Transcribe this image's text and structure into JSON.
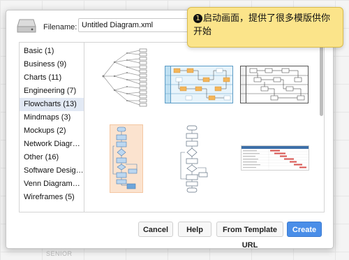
{
  "dialog": {
    "filename_label": "Filename:",
    "filename_value": "Untitled Diagram.xml"
  },
  "categories": [
    {
      "label": "Basic (1)",
      "selected": false
    },
    {
      "label": "Business (9)",
      "selected": false
    },
    {
      "label": "Charts (11)",
      "selected": false
    },
    {
      "label": "Engineering (7)",
      "selected": false
    },
    {
      "label": "Flowcharts (13)",
      "selected": true
    },
    {
      "label": "Mindmaps (3)",
      "selected": false
    },
    {
      "label": "Mockups (2)",
      "selected": false
    },
    {
      "label": "Network Diagra…",
      "selected": false
    },
    {
      "label": "Other (16)",
      "selected": false
    },
    {
      "label": "Software Design …",
      "selected": false
    },
    {
      "label": "Venn Diagrams (2)",
      "selected": false
    },
    {
      "label": "Wireframes (5)",
      "selected": false
    }
  ],
  "templates": [
    {
      "name": "template-mindmap-tree",
      "selected": false
    },
    {
      "name": "template-swimlane-blue",
      "selected": false
    },
    {
      "name": "template-swimlane-grey",
      "selected": false
    },
    {
      "name": "template-flowchart-blue",
      "selected": true
    },
    {
      "name": "template-flowchart-grey",
      "selected": false
    },
    {
      "name": "template-gantt",
      "selected": false
    }
  ],
  "buttons": {
    "cancel": "Cancel",
    "help": "Help",
    "from_template_url": "From Template URL",
    "create": "Create"
  },
  "tooltip": {
    "number": "1",
    "text": "启动画面，提供了很多模版供你开始"
  },
  "background": {
    "left_text": "SENIOR"
  },
  "colors": {
    "primary": "#4a8ee8",
    "selection": "#e2e9f4",
    "tooltip": "#fbe48a",
    "template_selected": "#fbe3cf"
  }
}
